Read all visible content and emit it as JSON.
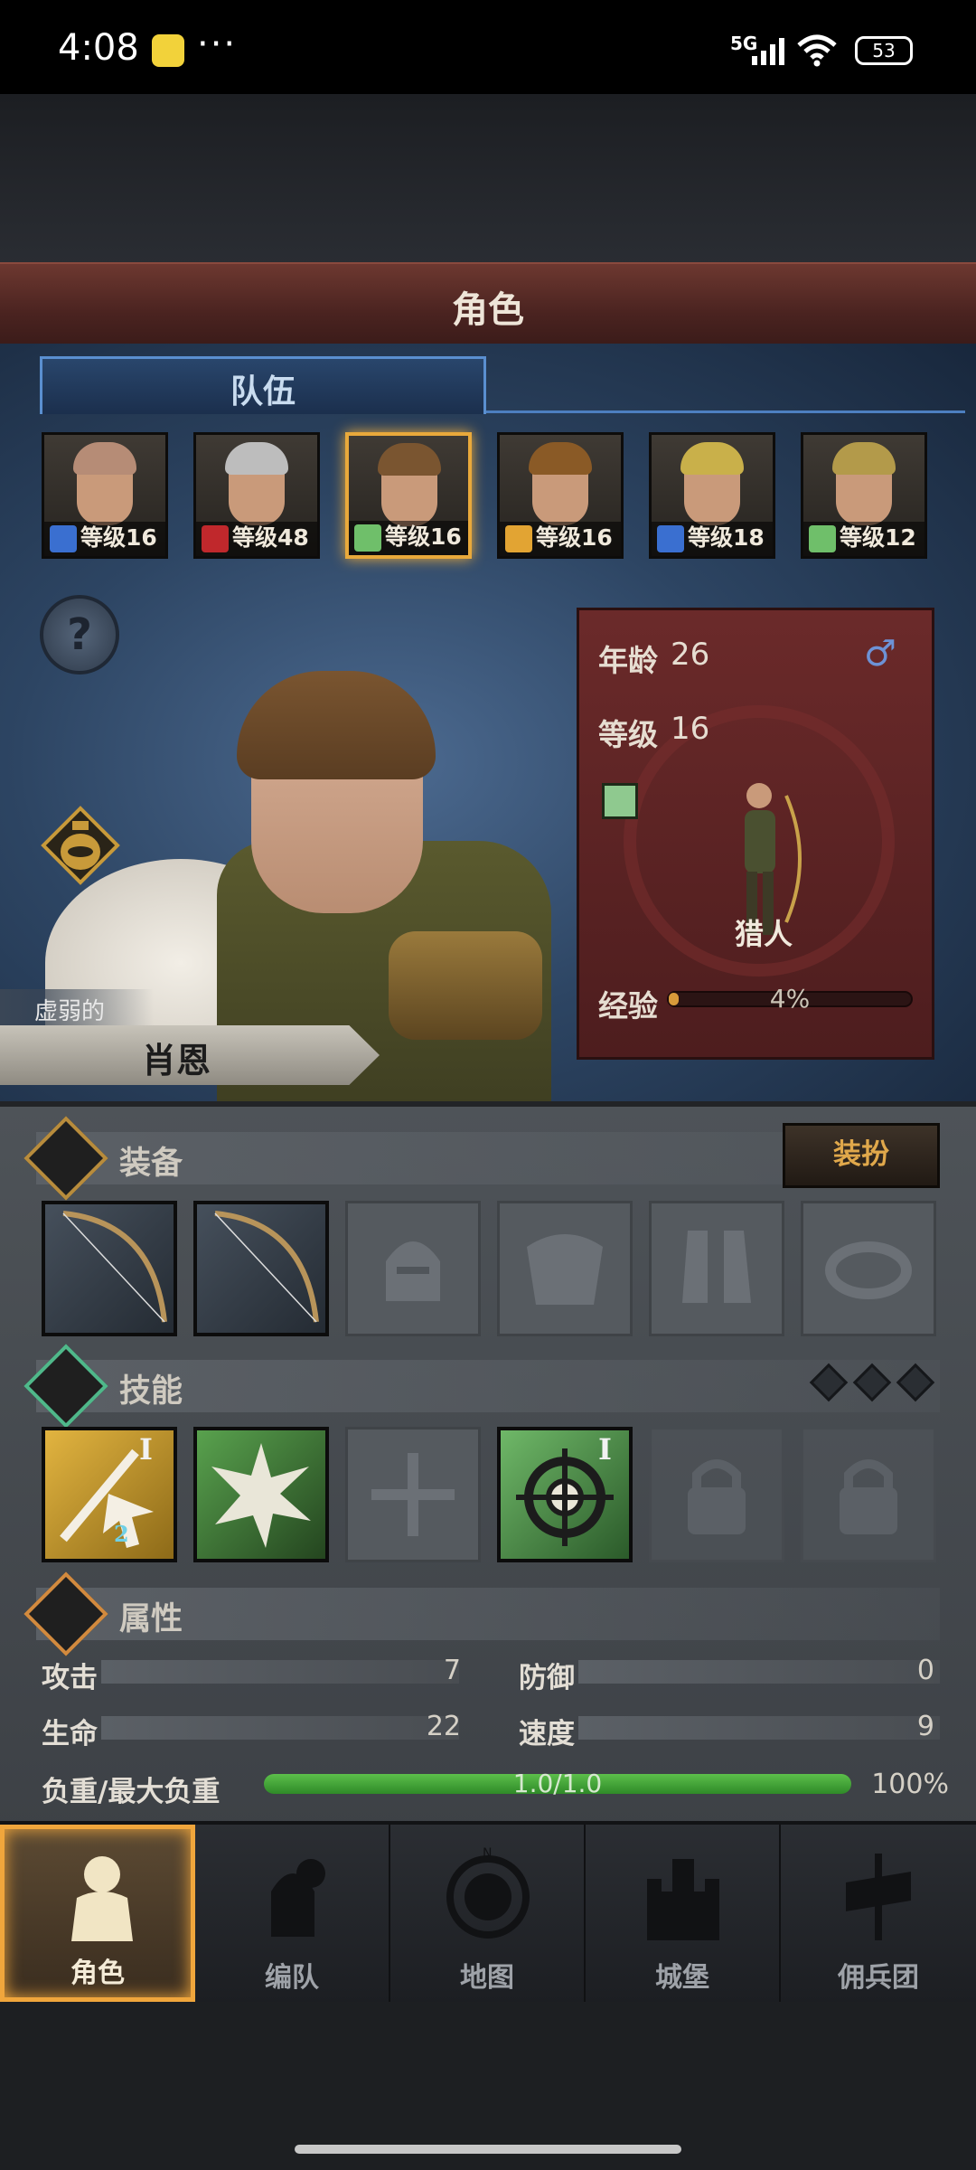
{
  "status": {
    "time": "4:08",
    "dots": "···",
    "network": "5G",
    "battery": "53"
  },
  "title": "角色",
  "team_tab": "队伍",
  "team": [
    {
      "level": "等级16",
      "class_color": "#3a6fd0",
      "hair": "#b68c76",
      "selected": false
    },
    {
      "level": "等级48",
      "class_color": "#c0282c",
      "hair": "#bdbdbd",
      "selected": false
    },
    {
      "level": "等级16",
      "class_color": "#6fbf6a",
      "hair": "#7a5530",
      "selected": true
    },
    {
      "level": "等级16",
      "class_color": "#e2a433",
      "hair": "#8a5a26",
      "selected": false
    },
    {
      "level": "等级18",
      "class_color": "#3a6fd0",
      "hair": "#c9b04a",
      "selected": false
    },
    {
      "level": "等级12",
      "class_color": "#6fbf6a",
      "hair": "#b39a4a",
      "selected": false
    }
  ],
  "character": {
    "trait": "虚弱的",
    "name": "肖恩",
    "age_label": "年龄",
    "age": "26",
    "level_label": "等级",
    "level": "16",
    "gender_icon": "♂",
    "class_name": "猎人",
    "exp_label": "经验",
    "exp_pct": "4%",
    "exp_fraction": 0.04
  },
  "equipment": {
    "title": "装备",
    "dress_button": "装扮",
    "slots": [
      "bow-icon",
      "bow-icon",
      "helmet-icon",
      "armor-icon",
      "boots-icon",
      "ring-icon"
    ]
  },
  "skills": {
    "title": "技能",
    "slots": [
      {
        "icon": "sword-cursor-icon",
        "rank": "I",
        "badge": "2"
      },
      {
        "icon": "bow-burst-icon",
        "rank": "",
        "badge": ""
      },
      {
        "icon": "cross-icon",
        "rank": "",
        "badge": ""
      },
      {
        "icon": "target-icon",
        "rank": "I",
        "badge": ""
      },
      {
        "icon": "lock-icon",
        "rank": "",
        "badge": ""
      },
      {
        "icon": "lock-icon",
        "rank": "",
        "badge": ""
      }
    ]
  },
  "attributes": {
    "title": "属性",
    "attack_label": "攻击",
    "attack": "7",
    "defense_label": "防御",
    "defense": "0",
    "hp_label": "生命",
    "hp": "22",
    "speed_label": "速度",
    "speed": "9",
    "load_label": "负重/最大负重",
    "load": "1.0/1.0",
    "load_pct": "100%",
    "load_fraction": 1.0
  },
  "nav": [
    {
      "label": "角色",
      "icon": "knight-icon",
      "active": true
    },
    {
      "label": "编队",
      "icon": "helmet-group-icon",
      "active": false
    },
    {
      "label": "地图",
      "icon": "compass-map-icon",
      "active": false
    },
    {
      "label": "城堡",
      "icon": "castle-icon",
      "active": false
    },
    {
      "label": "佣兵团",
      "icon": "banner-icon",
      "active": false
    }
  ],
  "colors": {
    "accent": "#e9a93b",
    "team_tab": "#5a8fd0",
    "title_bar": "#6d3830"
  }
}
